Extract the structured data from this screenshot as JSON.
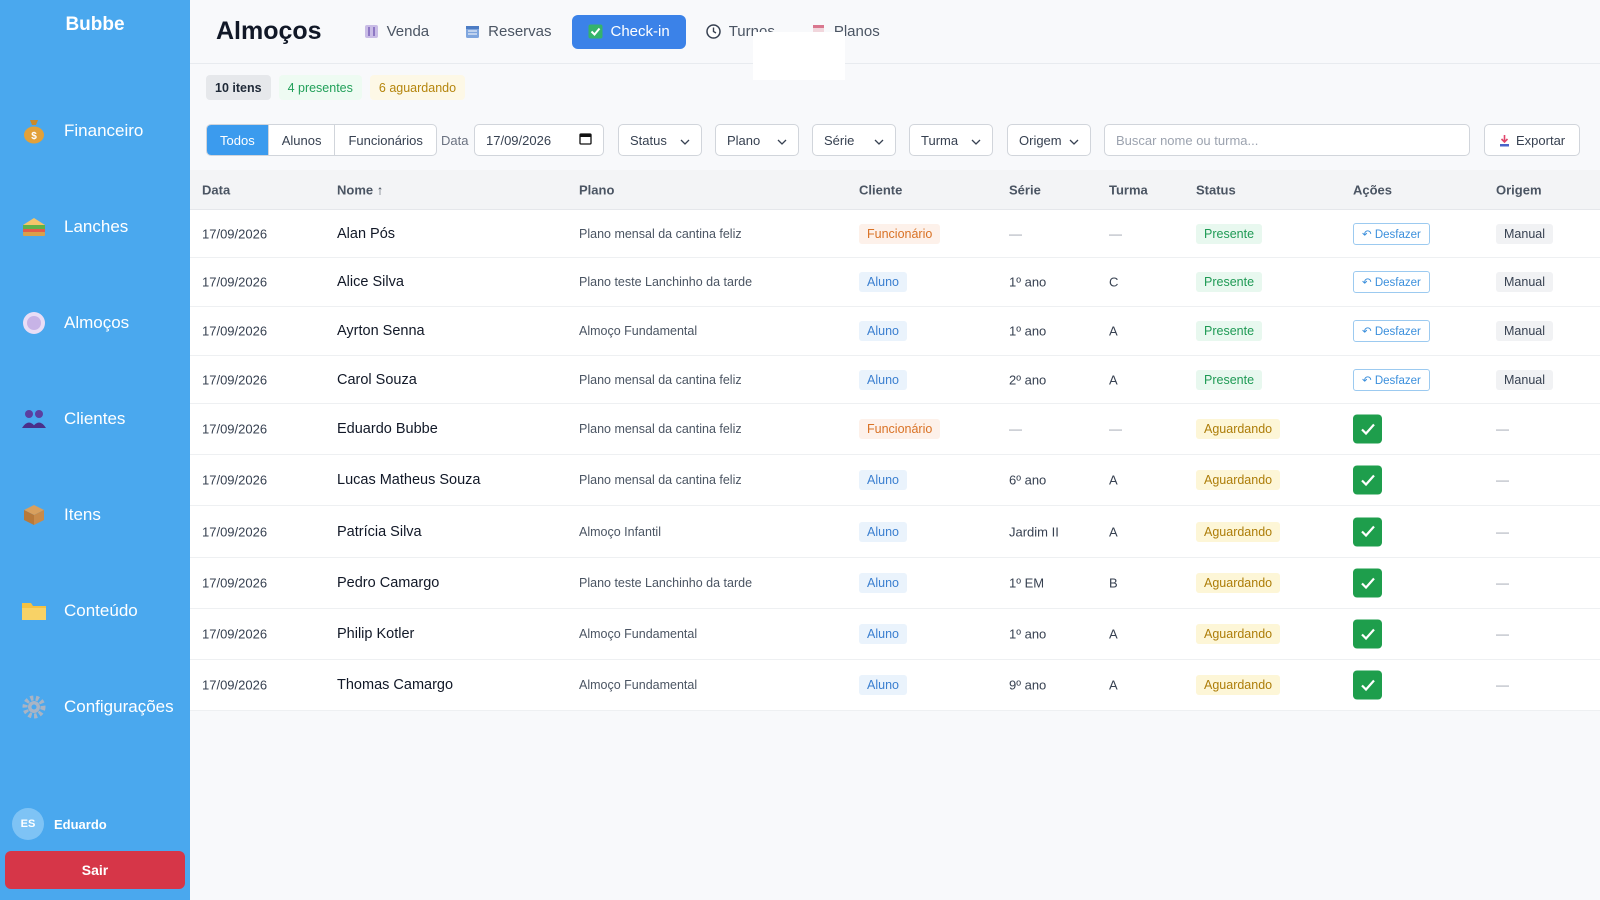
{
  "brand": "Bubbe",
  "sidebar": {
    "items": [
      {
        "label": "Financeiro",
        "icon": "money-bag-icon"
      },
      {
        "label": "Lanches",
        "icon": "sandwich-icon"
      },
      {
        "label": "Almoços",
        "icon": "plate-icon"
      },
      {
        "label": "Clientes",
        "icon": "users-icon"
      },
      {
        "label": "Itens",
        "icon": "box-icon"
      },
      {
        "label": "Conteúdo",
        "icon": "folder-icon"
      },
      {
        "label": "Configurações",
        "icon": "gear-icon"
      }
    ],
    "user": {
      "initials": "ES",
      "name": "Eduardo"
    },
    "logout_label": "Sair"
  },
  "header": {
    "title": "Almoços",
    "tabs": [
      {
        "label": "Venda",
        "icon": "cutlery-icon"
      },
      {
        "label": "Reservas",
        "icon": "calendar-icon"
      },
      {
        "label": "Check-in",
        "icon": "checkbox-icon",
        "active": true
      },
      {
        "label": "Turnos",
        "icon": "clock-icon"
      },
      {
        "label": "Planos",
        "icon": "calendar-page-icon"
      }
    ]
  },
  "counters": {
    "total": "10 itens",
    "present": "4 presentes",
    "waiting": "6 aguardando"
  },
  "filters": {
    "segments": [
      "Todos",
      "Alunos",
      "Funcionários"
    ],
    "date_label": "Data",
    "date_value": "17/09/2026",
    "status": "Status",
    "plano": "Plano",
    "serie": "Série",
    "turma": "Turma",
    "origem": "Origem",
    "search_placeholder": "Buscar nome ou turma...",
    "export_label": "Exportar"
  },
  "table": {
    "columns": [
      "Data",
      "Nome ↑",
      "Plano",
      "Cliente",
      "Série",
      "Turma",
      "Status",
      "Ações",
      "Origem"
    ],
    "undo_label": "Desfazer",
    "rows": [
      {
        "date": "17/09/2026",
        "name": "Alan Pós",
        "plan": "Plano mensal da cantina feliz",
        "client": "Funcionário",
        "serie": "—",
        "turma": "—",
        "status": "Presente",
        "origin": "Manual"
      },
      {
        "date": "17/09/2026",
        "name": "Alice Silva",
        "plan": "Plano teste Lanchinho da tarde",
        "client": "Aluno",
        "serie": "1º ano",
        "turma": "C",
        "status": "Presente",
        "origin": "Manual"
      },
      {
        "date": "17/09/2026",
        "name": "Ayrton Senna",
        "plan": "Almoço Fundamental",
        "client": "Aluno",
        "serie": "1º ano",
        "turma": "A",
        "status": "Presente",
        "origin": "Manual"
      },
      {
        "date": "17/09/2026",
        "name": "Carol Souza",
        "plan": "Plano mensal da cantina feliz",
        "client": "Aluno",
        "serie": "2º ano",
        "turma": "A",
        "status": "Presente",
        "origin": "Manual"
      },
      {
        "date": "17/09/2026",
        "name": "Eduardo Bubbe",
        "plan": "Plano mensal da cantina feliz",
        "client": "Funcionário",
        "serie": "—",
        "turma": "—",
        "status": "Aguardando",
        "origin": "—"
      },
      {
        "date": "17/09/2026",
        "name": "Lucas Matheus Souza",
        "plan": "Plano mensal da cantina feliz",
        "client": "Aluno",
        "serie": "6º ano",
        "turma": "A",
        "status": "Aguardando",
        "origin": "—"
      },
      {
        "date": "17/09/2026",
        "name": "Patrícia Silva",
        "plan": "Almoço Infantil",
        "client": "Aluno",
        "serie": "Jardim II",
        "turma": "A",
        "status": "Aguardando",
        "origin": "—"
      },
      {
        "date": "17/09/2026",
        "name": "Pedro Camargo",
        "plan": "Plano teste Lanchinho da tarde",
        "client": "Aluno",
        "serie": "1º EM",
        "turma": "B",
        "status": "Aguardando",
        "origin": "—"
      },
      {
        "date": "17/09/2026",
        "name": "Philip Kotler",
        "plan": "Almoço Fundamental",
        "client": "Aluno",
        "serie": "1º ano",
        "turma": "A",
        "status": "Aguardando",
        "origin": "—"
      },
      {
        "date": "17/09/2026",
        "name": "Thomas Camargo",
        "plan": "Almoço Fundamental",
        "client": "Aluno",
        "serie": "9º ano",
        "turma": "A",
        "status": "Aguardando",
        "origin": "—"
      }
    ]
  },
  "colors": {
    "sidebar": "#4aa8ee",
    "accent": "#3b82e8",
    "present": "#1f9a55",
    "waiting": "#ad7d09",
    "check": "#1e9e4c",
    "logout": "#d63648"
  }
}
